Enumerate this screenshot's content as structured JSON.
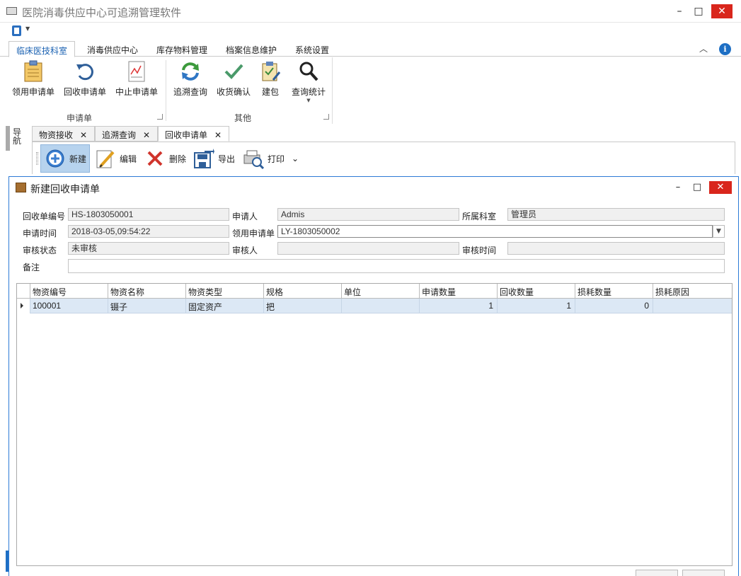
{
  "app": {
    "title": "医院消毒供应中心可追溯管理软件",
    "minimize": "–",
    "maximize": "□",
    "close": "✕"
  },
  "ribbon_tabs": [
    "临床医技科室",
    "消毒供应中心",
    "库存物料管理",
    "档案信息维护",
    "系统设置"
  ],
  "ribbon": {
    "group1_label": "申请单",
    "group2_label": "其他",
    "buttons": [
      {
        "label": "领用申请单",
        "icon": "clipboard-note-icon"
      },
      {
        "label": "回收申请单",
        "icon": "refresh-icon"
      },
      {
        "label": "中止申请单",
        "icon": "chart-document-icon"
      },
      {
        "label": "追溯查询",
        "icon": "sync-icon"
      },
      {
        "label": "收货确认",
        "icon": "check-icon"
      },
      {
        "label": "建包",
        "icon": "clipboard-edit-icon"
      },
      {
        "label": "查询统计",
        "icon": "magnifier-icon"
      }
    ],
    "collapse": "︿",
    "info": "i"
  },
  "side_tab": "导航",
  "doc_tabs": [
    {
      "label": "物资接收",
      "close": "✕"
    },
    {
      "label": "追溯查询",
      "close": "✕"
    },
    {
      "label": "回收申请单",
      "close": "✕"
    }
  ],
  "toolbar": {
    "new": "新建",
    "edit": "编辑",
    "delete": "删除",
    "export": "导出",
    "print": "打印",
    "more": "⌄"
  },
  "dialog": {
    "title": "新建回收申请单",
    "minimize": "–",
    "maximize": "□",
    "close": "✕",
    "form": {
      "recycle_no_label": "回收单编号",
      "recycle_no": "HS-1803050001",
      "applicant_label": "申请人",
      "applicant": "Admis",
      "dept_label": "所属科室",
      "dept": "管理员",
      "apply_time_label": "申请时间",
      "apply_time": "2018-03-05,09:54:22",
      "requisition_label": "领用申请单",
      "requisition": "LY-1803050002",
      "audit_status_label": "审核状态",
      "audit_status": "未审核",
      "auditor_label": "审核人",
      "auditor": "",
      "audit_time_label": "审核时间",
      "audit_time": "",
      "remark_label": "备注",
      "remark": ""
    },
    "grid": {
      "columns": [
        "物资编号",
        "物资名称",
        "物资类型",
        "规格",
        "单位",
        "申请数量",
        "回收数量",
        "损耗数量",
        "损耗原因"
      ],
      "rows": [
        [
          "100001",
          "镊子",
          "固定资产",
          "把",
          "",
          "1",
          "1",
          "0",
          ""
        ]
      ]
    }
  }
}
